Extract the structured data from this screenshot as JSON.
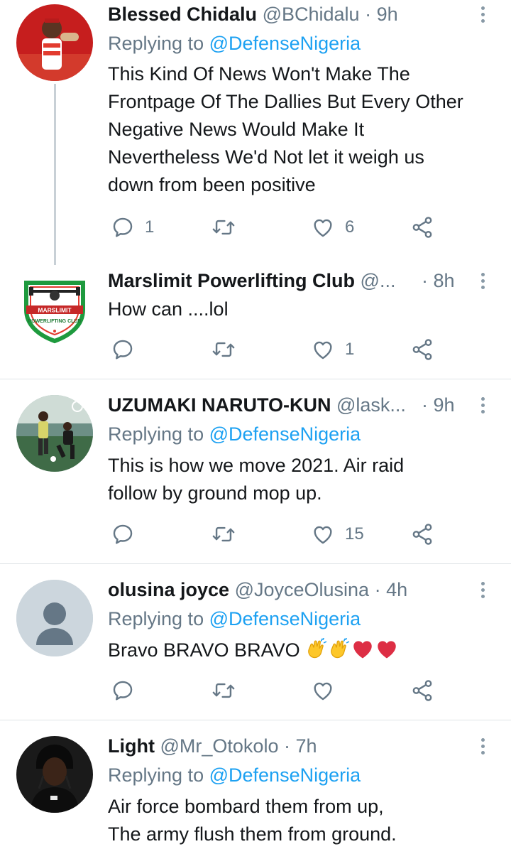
{
  "colors": {
    "link": "#1da1f2",
    "muted": "#657786",
    "text": "#14171a",
    "separator": "#dfe3e6",
    "thread_line": "#c8d0d6"
  },
  "tweets": [
    {
      "name": "Blessed Chidalu",
      "handle": "@BChidalu",
      "dot": "·",
      "time": "9h",
      "replying_prefix": "Replying to",
      "replying_target": "@DefenseNigeria",
      "lines": [
        "This Kind Of News Won't Make The",
        "Frontpage Of The Dallies But Every Other",
        "Negative News Would Make It",
        "Nevertheless We'd Not let it weigh us",
        "down from been positive"
      ],
      "reply_count": "1",
      "retweet_count": "",
      "like_count": "6",
      "avatar_icon": "person-photo"
    },
    {
      "name": "Marslimit Powerlifting Club",
      "handle": "@...",
      "dot": "·",
      "time": "8h",
      "lines": [
        "How can ....lol"
      ],
      "reply_count": "",
      "retweet_count": "",
      "like_count": "1",
      "avatar_icon": "club-logo",
      "logo_text_top": "MARSLIMIT",
      "logo_text_bottom": "POWERLIFTING CLUB"
    },
    {
      "name": "UZUMAKI NARUTO-KUN",
      "handle": "@lask...",
      "dot": "·",
      "time": "9h",
      "replying_prefix": "Replying to",
      "replying_target": "@DefenseNigeria",
      "lines": [
        "This is how we move 2021. Air raid",
        "follow by ground mop up."
      ],
      "reply_count": "",
      "retweet_count": "",
      "like_count": "15",
      "avatar_icon": "football-photo"
    },
    {
      "name": "olusina joyce",
      "handle": "@JoyceOlusina",
      "dot": "·",
      "time": "4h",
      "replying_prefix": "Replying to",
      "replying_target": "@DefenseNigeria",
      "lines": [
        "Bravo BRAVO BRAVO"
      ],
      "emojis": [
        "clapping-hands-emoji",
        "clapping-hands-emoji",
        "red-heart-emoji",
        "red-heart-emoji"
      ],
      "reply_count": "",
      "retweet_count": "",
      "like_count": "",
      "avatar_icon": "default-avatar"
    },
    {
      "name": "Light",
      "handle": "@Mr_Otokolo",
      "dot": "·",
      "time": "7h",
      "replying_prefix": "Replying to",
      "replying_target": "@DefenseNigeria",
      "lines": [
        "Air force bombard them from up,",
        "The army flush them from ground."
      ],
      "avatar_icon": "person-photo-dark"
    }
  ]
}
